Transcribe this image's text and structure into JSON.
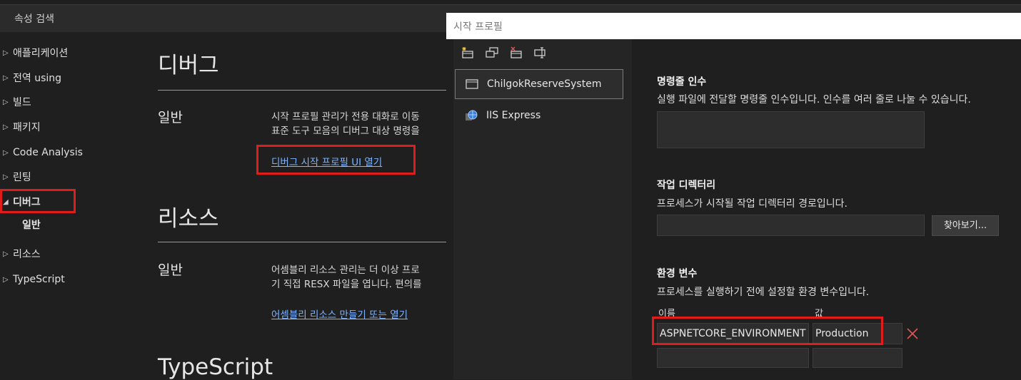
{
  "search": {
    "placeholder": "속성 검색"
  },
  "nav": {
    "items": [
      {
        "label": "애플리케이션",
        "expanded": false
      },
      {
        "label": "전역 using",
        "expanded": false
      },
      {
        "label": "빌드",
        "expanded": false
      },
      {
        "label": "패키지",
        "expanded": false
      },
      {
        "label": "Code Analysis",
        "expanded": false
      },
      {
        "label": "린팅",
        "expanded": false
      },
      {
        "label": "디버그",
        "expanded": true,
        "children": [
          "일반"
        ]
      },
      {
        "label": "리소스",
        "expanded": false
      },
      {
        "label": "TypeScript",
        "expanded": false
      }
    ]
  },
  "main": {
    "debug": {
      "title": "디버그",
      "section": "일반",
      "desc_line1": "시작 프로필 관리가 전용 대화로 이동",
      "desc_line2": "표준 도구 모음의 디버그 대상 명령을",
      "link": "디버그 시작 프로필 UI 열기"
    },
    "resources": {
      "title": "리소스",
      "section": "일반",
      "desc_line1": "어셈블리 리소스 관리는 더 이상 프로",
      "desc_line2": "기 직접 RESX 파일을 엽니다. 편의를",
      "link": "어셈블리 리소스 만들기 또는 열기"
    },
    "typescript": {
      "title": "TypeScript"
    }
  },
  "dialog": {
    "title": "시작 프로필",
    "toolbar": [
      "new-profile-icon",
      "duplicate-profile-icon",
      "delete-profile-icon",
      "rename-profile-icon"
    ],
    "profiles": [
      {
        "label": "ChilgokReserveSystem",
        "icon": "window-icon",
        "selected": true
      },
      {
        "label": "IIS Express",
        "icon": "globe-icon",
        "selected": false
      }
    ],
    "args": {
      "label": "명령줄 인수",
      "desc": "실행 파일에 전달할 명령줄 인수입니다. 인수를 여러 줄로 나눌 수 있습니다.",
      "value": ""
    },
    "workdir": {
      "label": "작업 디렉터리",
      "desc": "프로세스가 시작될 작업 디렉터리 경로입니다.",
      "value": "",
      "browse": "찾아보기..."
    },
    "env": {
      "label": "환경 변수",
      "desc": "프로세스를 실행하기 전에 설정할 환경 변수입니다.",
      "col_name": "이름",
      "col_value": "값",
      "rows": [
        {
          "name": "ASPNETCORE_ENVIRONMENT",
          "value": "Production"
        },
        {
          "name": "",
          "value": ""
        }
      ]
    }
  },
  "colors": {
    "highlight": "#e21b1b",
    "link": "#7fb4ff",
    "delete": "#e05555"
  }
}
